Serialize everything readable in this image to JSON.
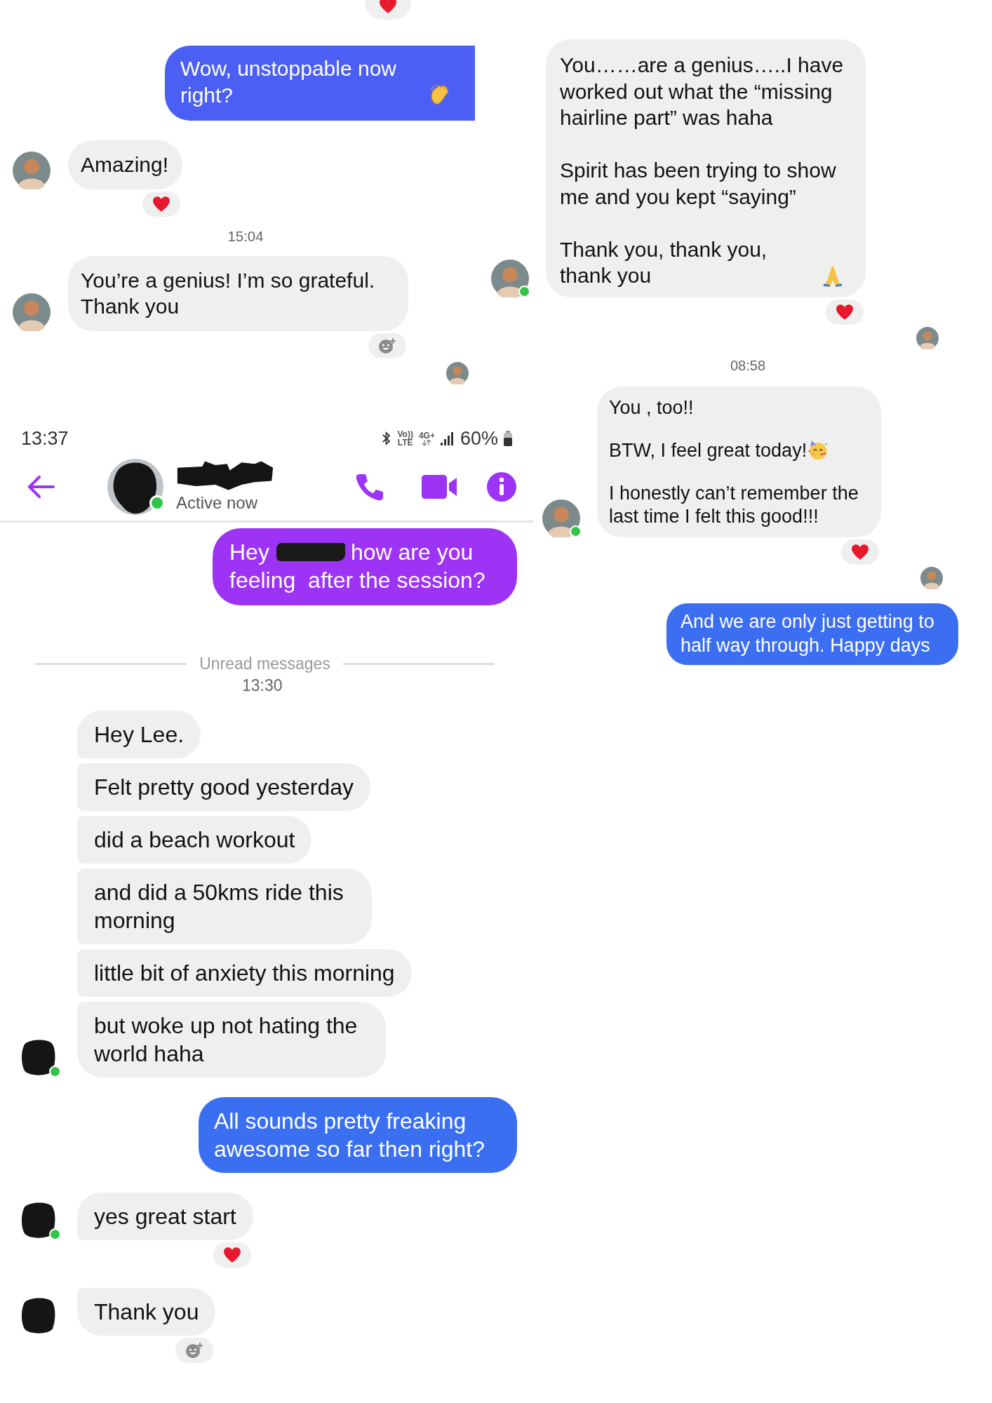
{
  "top_left_thread": {
    "items": [
      {
        "kind": "reaction_stub",
        "reaction": {
          "kind": "heart"
        }
      },
      {
        "kind": "outgoing",
        "color": "#4b5ff5",
        "paragraphs": [
          {
            "text": "Wow, unstoppable now right?",
            "emoji": {
              "kind": "clap"
            }
          }
        ]
      },
      {
        "kind": "incoming",
        "avatar": {
          "kind": "photo",
          "online": false
        },
        "reaction": {
          "kind": "heart"
        },
        "paragraphs": [
          {
            "text": "Amazing!"
          }
        ]
      },
      {
        "kind": "timestamp",
        "text": "15:04"
      },
      {
        "kind": "incoming",
        "avatar": {
          "kind": "photo",
          "online": false
        },
        "reaction": {
          "kind": "add"
        },
        "paragraphs": [
          {
            "text": "You’re a genius! I’m so grateful. Thank you"
          }
        ]
      },
      {
        "kind": "seen",
        "avatar": {
          "kind": "photo"
        }
      }
    ]
  },
  "right_thread": {
    "items": [
      {
        "kind": "incoming",
        "avatar": {
          "kind": "photo",
          "online": true
        },
        "reaction": {
          "kind": "heart"
        },
        "paragraphs": [
          {
            "text": "You……are a genius…..I have worked out what the “missing hairline part” was haha"
          },
          {
            "text": "Spirit has been trying to show me and you kept “saying”"
          },
          {
            "text": "Thank you, thank you, thank you",
            "emoji": {
              "kind": "pray"
            }
          }
        ]
      },
      {
        "kind": "seen",
        "avatar": {
          "kind": "photo"
        }
      },
      {
        "kind": "timestamp",
        "text": "08:58"
      },
      {
        "kind": "incoming",
        "avatar": {
          "kind": "photo",
          "online": true
        },
        "reaction": {
          "kind": "heart"
        },
        "paragraphs": [
          {
            "text": "You , too!!"
          },
          {
            "text": "BTW, I feel great today!",
            "emoji": {
              "kind": "party"
            }
          },
          {
            "text": "I honestly can’t remember the last time I felt this good!!!"
          }
        ]
      },
      {
        "kind": "seen",
        "avatar": {
          "kind": "photo"
        }
      },
      {
        "kind": "outgoing",
        "color": "#3b6ef0",
        "paragraphs": [
          {
            "text": "And we are only just getting to half way through. Happy days"
          }
        ]
      }
    ]
  },
  "main_thread": {
    "status_bar": {
      "time": "13:37",
      "volte_top": "Vo))",
      "volte_bottom": "LTE",
      "network": "4G+",
      "battery": "60%"
    },
    "header": {
      "status": "Active now",
      "online": true
    },
    "items": [
      {
        "kind": "outgoing",
        "color": "#9c33f5",
        "lines": [
          [
            {
              "kind": "text",
              "text": "Hey"
            },
            {
              "kind": "redaction"
            },
            {
              "kind": "text",
              "text": "how are you"
            }
          ],
          [
            {
              "kind": "text",
              "text": "feeling  after the session?"
            }
          ]
        ]
      },
      {
        "kind": "unread",
        "text": "Unread messages"
      },
      {
        "kind": "timestamp",
        "text": "13:30"
      },
      {
        "kind": "incoming",
        "paragraphs": [
          {
            "text": "Hey Lee."
          }
        ]
      },
      {
        "kind": "incoming",
        "paragraphs": [
          {
            "text": "Felt pretty good yesterday"
          }
        ]
      },
      {
        "kind": "incoming",
        "paragraphs": [
          {
            "text": "did a beach workout"
          }
        ]
      },
      {
        "kind": "incoming",
        "paragraphs": [
          {
            "text": "and did a 50kms ride this morning"
          }
        ]
      },
      {
        "kind": "incoming",
        "paragraphs": [
          {
            "text": "little bit of anxiety this morning"
          }
        ]
      },
      {
        "kind": "incoming",
        "avatar": {
          "kind": "redacted",
          "online": true
        },
        "paragraphs": [
          {
            "text": "but woke up not hating the world haha"
          }
        ]
      },
      {
        "kind": "outgoing",
        "color": "#3a6ff2",
        "paragraphs": [
          {
            "text": "All sounds pretty freaking awesome so far then right?"
          }
        ]
      },
      {
        "kind": "incoming",
        "avatar": {
          "kind": "redacted",
          "online": true
        },
        "reaction": {
          "kind": "heart"
        },
        "paragraphs": [
          {
            "text": "yes great start"
          }
        ]
      },
      {
        "kind": "incoming",
        "avatar": {
          "kind": "redacted",
          "online": false
        },
        "reaction": {
          "kind": "add"
        },
        "paragraphs": [
          {
            "text": "Thank you"
          }
        ]
      }
    ]
  }
}
